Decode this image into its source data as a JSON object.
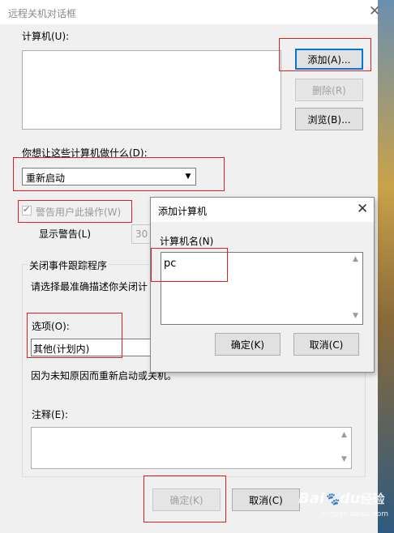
{
  "main_dialog": {
    "title": "远程关机对话框",
    "computers_label": "计算机(U):",
    "add_button": "添加(A)...",
    "remove_button": "删除(R)",
    "browse_button": "浏览(B)...",
    "action_label": "你想让这些计算机做什么(D):",
    "action_value": "重新启动",
    "warn_checkbox_label": "警告用户此操作(W)",
    "warn_checked": true,
    "display_warning_label": "显示警告(L)",
    "display_warning_value": "30",
    "event_tracker_group": "关闭事件跟踪程序",
    "choose_reason_text": "请选择最准确描述你关闭计",
    "option_label": "选项(O):",
    "option_value": "其他(计划内)",
    "reason_desc": "因为未知原因而重新启动或关机。",
    "comment_label": "注释(E):",
    "comment_value": "",
    "ok_button": "确定(K)",
    "cancel_button": "取消(C)"
  },
  "add_dialog": {
    "title": "添加计算机",
    "name_label": "计算机名(N)",
    "name_value": "pc",
    "ok_button": "确定(K)",
    "cancel_button": "取消(C)"
  },
  "watermark": {
    "brand": "Bai",
    "paw": "du",
    "suffix": "经验",
    "url": "jingyan.baidu.com"
  },
  "colors": {
    "highlight": "#e0201f",
    "focus": "#0078d7",
    "dialog_bg": "#f0f0f0"
  },
  "icons": {
    "close": "close-icon",
    "dropdown": "chevron-down-icon",
    "checkbox": "checkmark-icon"
  }
}
